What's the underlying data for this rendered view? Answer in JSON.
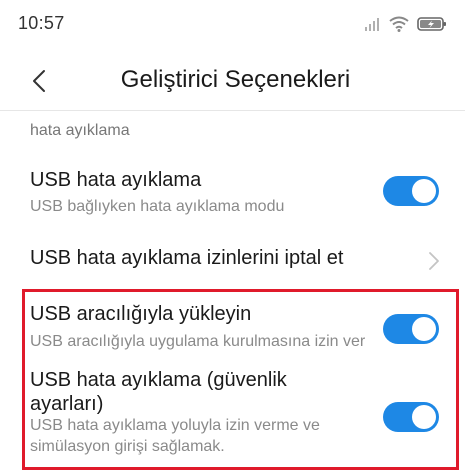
{
  "status_bar": {
    "time": "10:57",
    "icons": [
      "signal-icon",
      "wifi-icon",
      "battery-charging-icon"
    ]
  },
  "header": {
    "title": "Geliştirici Seçenekleri",
    "back_icon": "chevron-left-icon"
  },
  "section": {
    "title": "hata ayıklama"
  },
  "settings": [
    {
      "title": "USB hata ayıklama",
      "subtitle": "USB bağlıyken hata ayıklama modu",
      "toggle": true
    },
    {
      "title": "USB hata ayıklama izinlerini iptal et",
      "icon": "chevron-right-icon"
    },
    {
      "title": "USB aracılığıyla yükleyin",
      "subtitle": "USB aracılığıyla uygulama kurulmasına izin ver",
      "toggle": true
    },
    {
      "title_line1": "USB hata ayıklama (güvenlik",
      "title_line2": "ayarları)",
      "subtitle_line1": "USB hata ayıklama yoluyla izin verme ve",
      "subtitle_line2": "simülasyon girişi sağlamak.",
      "toggle": true
    }
  ],
  "colors": {
    "toggle_on": "#1e88e5",
    "highlight": "#e01a2b"
  }
}
